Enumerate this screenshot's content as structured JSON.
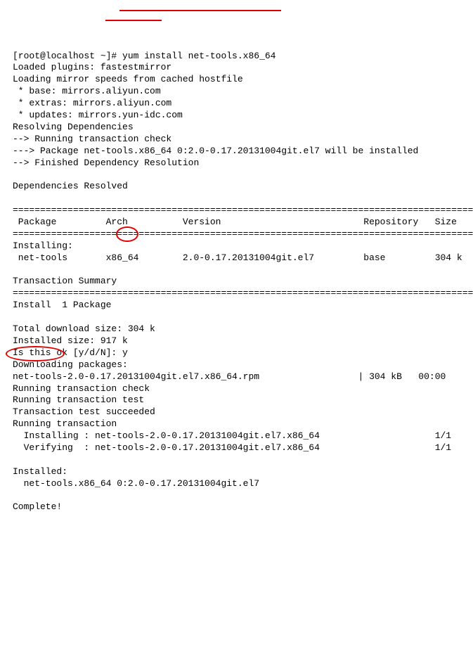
{
  "terminal": {
    "prompt": "[root@localhost ~]# ",
    "command": "yum install net-tools.x86_64",
    "l01": "Loaded plugins: fastestmirror",
    "l02": "Loading mirror speeds from cached hostfile",
    "l03": " * base: mirrors.aliyun.com",
    "l04": " * extras: mirrors.aliyun.com",
    "l05": " * updates: mirrors.yun-idc.com",
    "l06": "Resolving Dependencies",
    "l07": "--> Running transaction check",
    "l08": "---> Package net-tools.x86_64 0:2.0-0.17.20131004git.el7 will be installed",
    "l09": "--> Finished Dependency Resolution",
    "l10": "",
    "l11": "Dependencies Resolved",
    "l12": "",
    "sep1": "=========================================================================================",
    "hdr": " Package         Arch          Version                          Repository   Size",
    "sep2": "=========================================================================================",
    "l13": "Installing:",
    "l14": " net-tools       x86_64        2.0-0.17.20131004git.el7         base         304 k",
    "l15": "",
    "l16": "Transaction Summary",
    "sep3": "=========================================================================================",
    "l17": "Install  1 Package",
    "l18": "",
    "l19": "Total download size: 304 k",
    "l20": "Installed size: 917 k",
    "l21a": "Is this ok [y/d/N]: ",
    "l21b": "y",
    "l22": "Downloading packages:",
    "l23": "net-tools-2.0-0.17.20131004git.el7.x86_64.rpm                  | 304 kB   00:00",
    "l24": "Running transaction check",
    "l25": "Running transaction test",
    "l26": "Transaction test succeeded",
    "l27": "Running transaction",
    "l28": "  Installing : net-tools-2.0-0.17.20131004git.el7.x86_64                     1/1",
    "l29": "  Verifying  : net-tools-2.0-0.17.20131004git.el7.x86_64                     1/1",
    "l30": "",
    "l31": "Installed:",
    "l32": "  net-tools.x86_64 0:2.0-0.17.20131004git.el7",
    "l33": "",
    "l34": "Complete!"
  }
}
